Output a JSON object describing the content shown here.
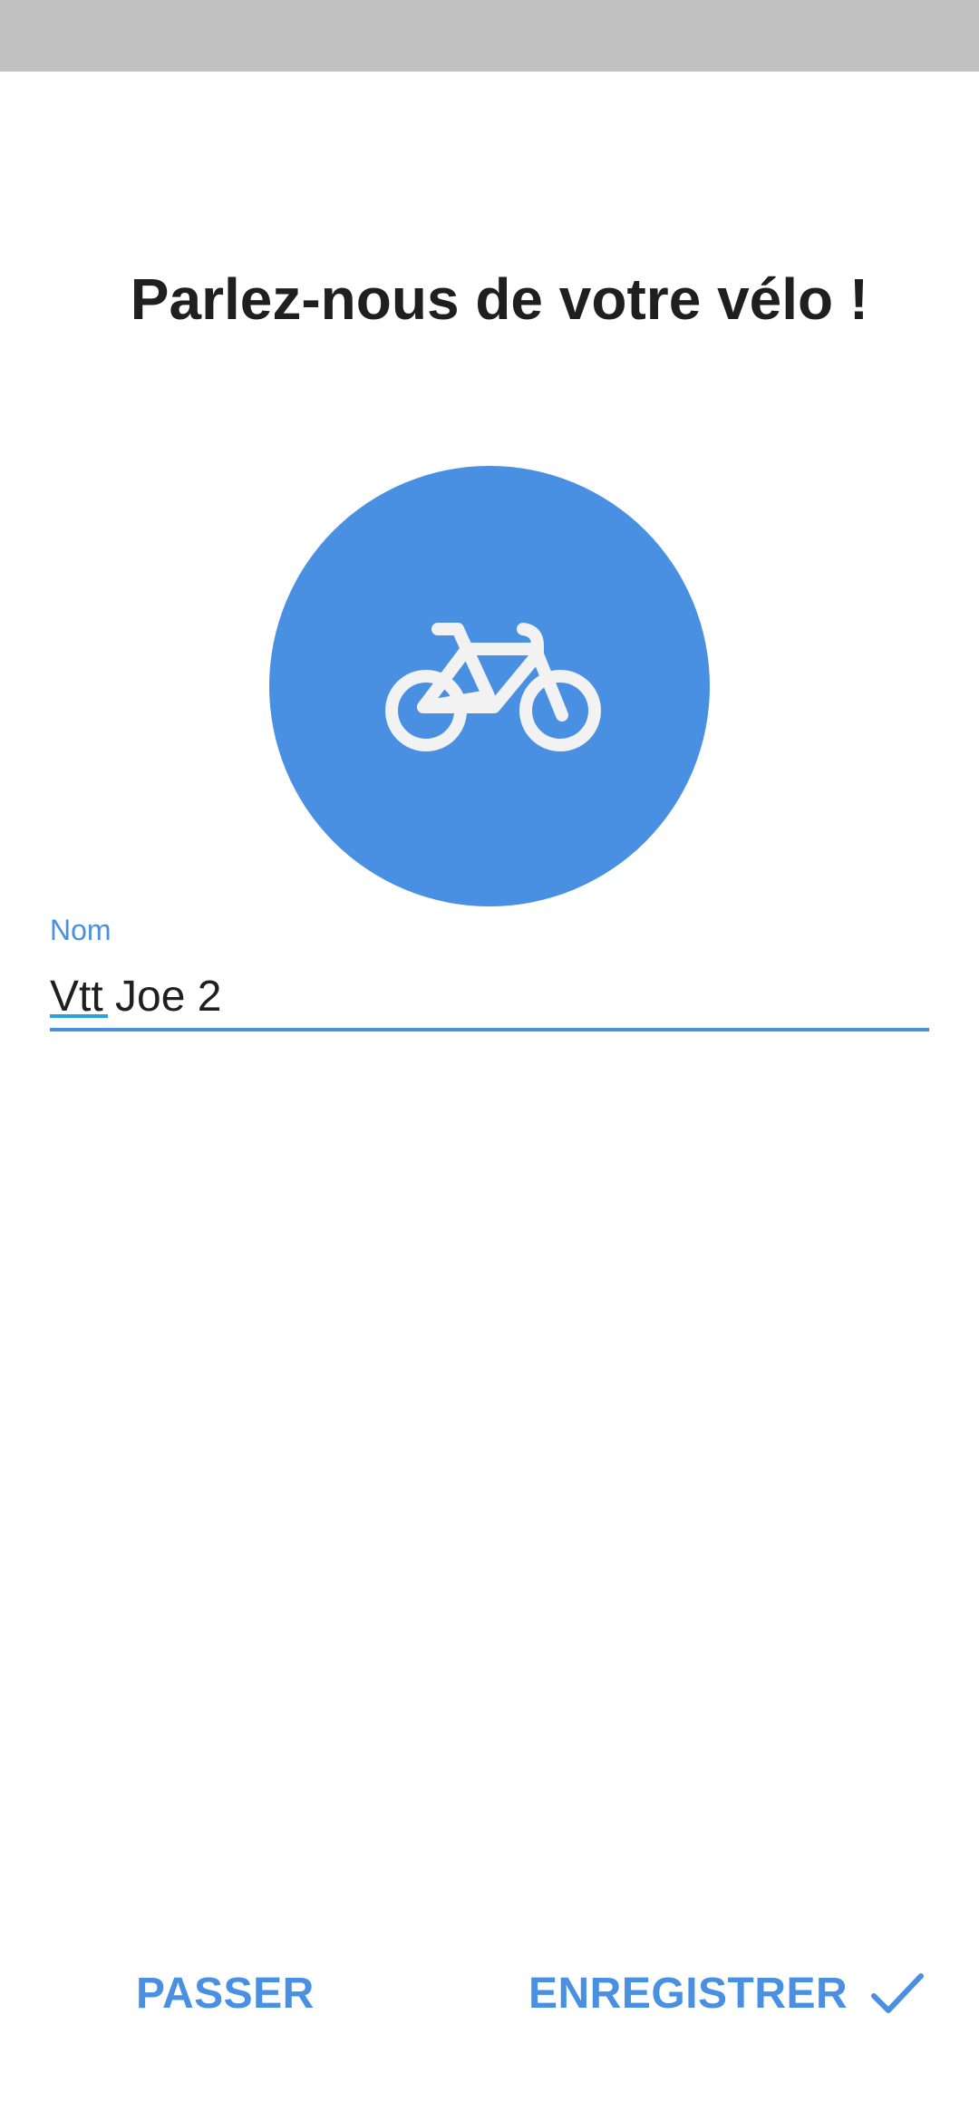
{
  "page": {
    "title": "Parlez-nous de votre vélo !"
  },
  "avatar": {
    "icon": "bicycle-icon",
    "color": "#4a90e2"
  },
  "name_field": {
    "label": "Nom",
    "value": "Vtt Joe 2"
  },
  "actions": {
    "skip_label": "PASSER",
    "save_label": "ENREGISTRER",
    "save_icon": "check-icon"
  },
  "colors": {
    "accent": "#4a90e2",
    "status_bar": "#c1c1c1",
    "text": "#1f1f1f"
  }
}
